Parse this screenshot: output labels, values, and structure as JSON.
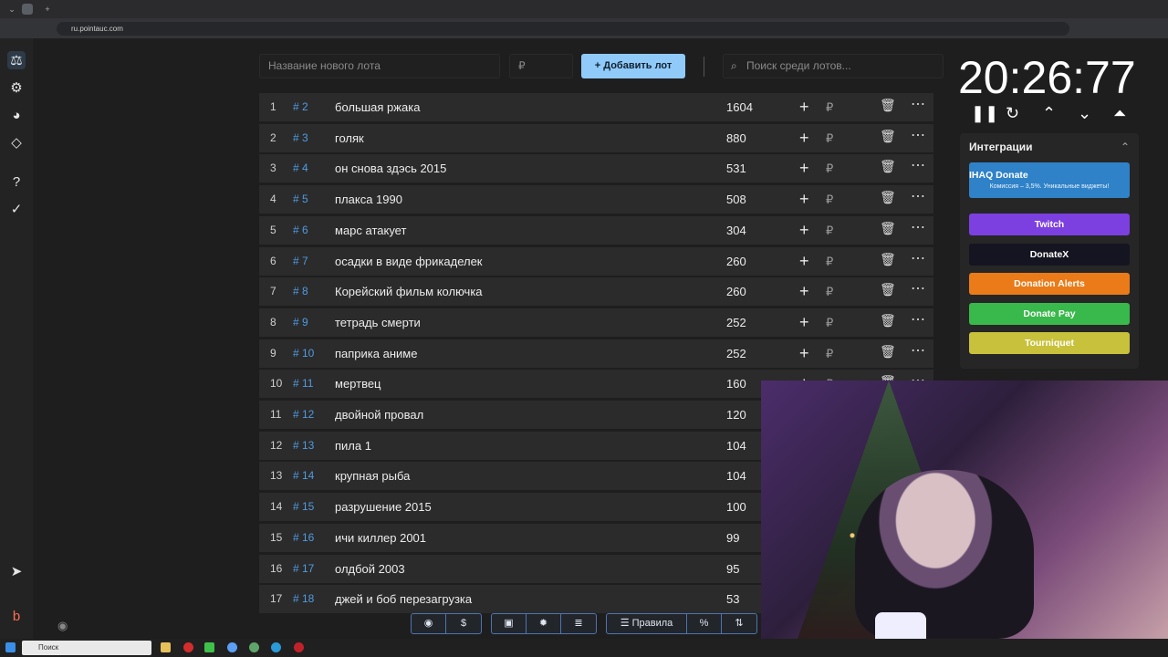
{
  "browser": {
    "url": "ru.pointauc.com",
    "tab_plus": "+"
  },
  "form": {
    "lot_placeholder": "Название нового лота",
    "price_placeholder": "₽",
    "add_label": "Добавить лот",
    "search_placeholder": "Поиск среди лотов..."
  },
  "timer": {
    "value": "20:26:77"
  },
  "integrations": {
    "title": "Интеграции",
    "buttons": [
      {
        "label": "IHAQ Donate",
        "sub": "Комиссия – 3,5%. Уникальные виджеты!",
        "color": "#2f82c8"
      },
      {
        "label": "Twitch",
        "color": "#7c3fe0"
      },
      {
        "label": "DonateX",
        "color": "#151421"
      },
      {
        "label": "Donation Alerts",
        "color": "#ea7b18"
      },
      {
        "label": "Donate Pay",
        "color": "#39b84b"
      },
      {
        "label": "Tourniquet",
        "color": "#c8c13b"
      }
    ]
  },
  "lots": [
    {
      "rank": "1",
      "id": "# 2",
      "name": "большая ржака",
      "amount": "1604"
    },
    {
      "rank": "2",
      "id": "# 3",
      "name": "голяк",
      "amount": "880"
    },
    {
      "rank": "3",
      "id": "# 4",
      "name": "он снова здэсь 2015",
      "amount": "531"
    },
    {
      "rank": "4",
      "id": "# 5",
      "name": "плакса 1990",
      "amount": "508"
    },
    {
      "rank": "5",
      "id": "# 6",
      "name": "марс атакует",
      "amount": "304"
    },
    {
      "rank": "6",
      "id": "# 7",
      "name": "осадки в виде фрикаделек",
      "amount": "260"
    },
    {
      "rank": "7",
      "id": "# 8",
      "name": "Корейский фильм колючка",
      "amount": "260"
    },
    {
      "rank": "8",
      "id": "# 9",
      "name": "тетрадь смерти",
      "amount": "252"
    },
    {
      "rank": "9",
      "id": "# 10",
      "name": "паприка аниме",
      "amount": "252"
    },
    {
      "rank": "10",
      "id": "# 11",
      "name": "мертвец",
      "amount": "160"
    },
    {
      "rank": "11",
      "id": "# 12",
      "name": " двойной провал",
      "amount": "120"
    },
    {
      "rank": "12",
      "id": "# 13",
      "name": "пила 1",
      "amount": "104"
    },
    {
      "rank": "13",
      "id": "# 14",
      "name": "крупная рыба",
      "amount": "104"
    },
    {
      "rank": "14",
      "id": "# 15",
      "name": "разрушение 2015",
      "amount": "100"
    },
    {
      "rank": "15",
      "id": "# 16",
      "name": "ичи киллер 2001",
      "amount": "99"
    },
    {
      "rank": "16",
      "id": "# 17",
      "name": "олдбой 2003",
      "amount": "95"
    },
    {
      "rank": "17",
      "id": "# 18",
      "name": "джей и боб перезагрузка",
      "amount": "53"
    }
  ],
  "toolbar": {
    "rules_label": "Правила"
  },
  "taskbar": {
    "search_label": "Поиск"
  },
  "icons": {
    "plus": "+",
    "ruble": "₽",
    "trash": "🗑",
    "dots": "⋯",
    "search": "⌕"
  }
}
